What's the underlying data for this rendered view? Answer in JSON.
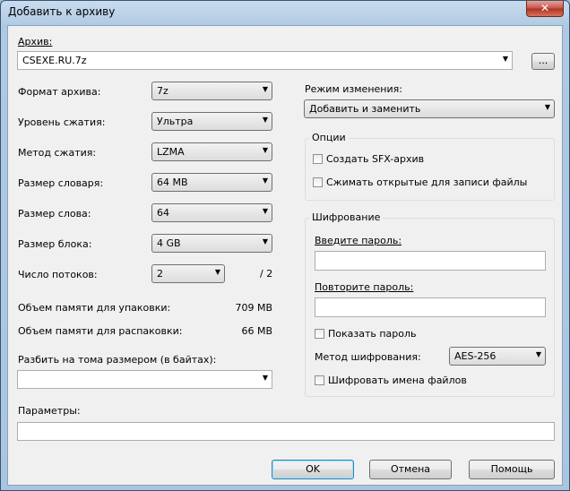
{
  "window": {
    "title": "Добавить к архиву",
    "close_glyph": "✕"
  },
  "archive": {
    "label": "Архив:",
    "value": "CSEXE.RU.7z",
    "browse_label": "..."
  },
  "settings": [
    {
      "label": "Формат архива:",
      "value": "7z"
    },
    {
      "label": "Уровень сжатия:",
      "value": "Ультра"
    },
    {
      "label": "Метод сжатия:",
      "value": "LZMA"
    },
    {
      "label": "Размер словаря:",
      "value": "64 MB"
    },
    {
      "label": "Размер слова:",
      "value": "64"
    },
    {
      "label": "Размер блока:",
      "value": "4 GB"
    }
  ],
  "threads": {
    "label": "Число потоков:",
    "value": "2",
    "max": "/ 2"
  },
  "memory": {
    "pack_label": "Объем памяти для упаковки:",
    "pack_value": "709 MB",
    "unpack_label": "Объем памяти для распаковки:",
    "unpack_value": "66 MB"
  },
  "split": {
    "label": "Разбить на тома размером (в байтах):",
    "value": ""
  },
  "params": {
    "label": "Параметры:",
    "value": ""
  },
  "update_mode": {
    "label": "Режим изменения:",
    "value": "Добавить и заменить"
  },
  "options": {
    "title": "Опции",
    "sfx_label": "Создать SFX-архив",
    "sfx_checked": false,
    "shared_label": "Сжимать открытые для записи файлы",
    "shared_checked": false
  },
  "encryption": {
    "title": "Шифрование",
    "password_label": "Введите пароль:",
    "repeat_label": "Повторите пароль:",
    "show_password_label": "Показать пароль",
    "method_label": "Метод шифрования:",
    "method_value": "AES-256",
    "encrypt_names_label": "Шифровать имена файлов"
  },
  "buttons": {
    "ok": "OK",
    "cancel": "Отмена",
    "help": "Помощь"
  }
}
